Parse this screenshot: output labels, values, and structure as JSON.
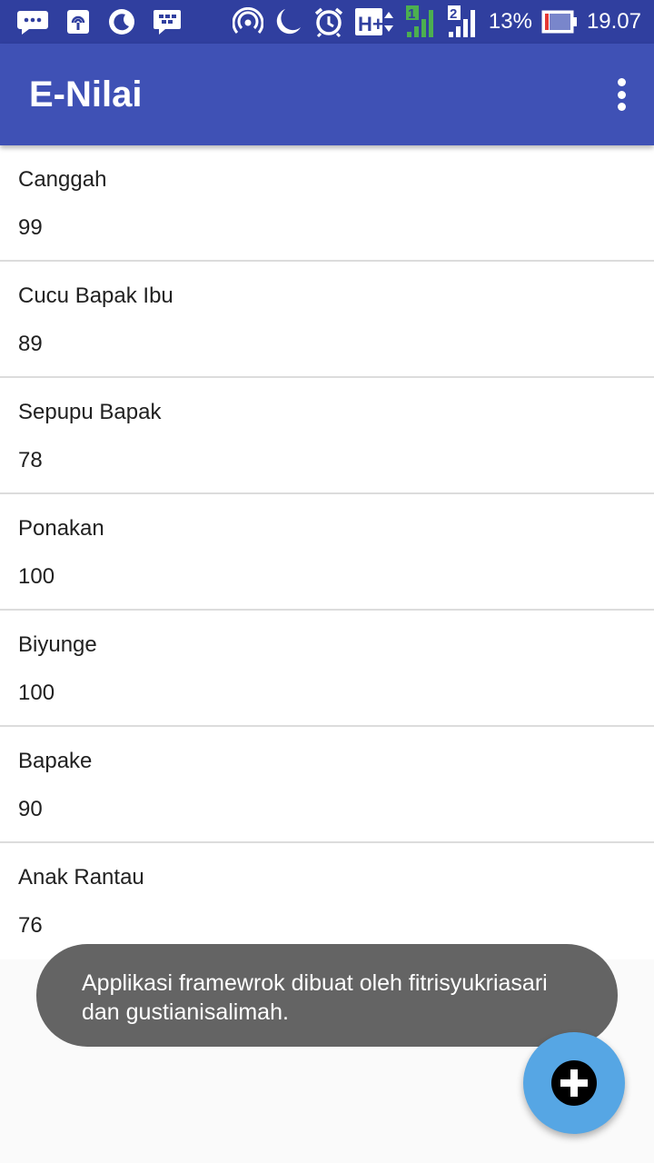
{
  "status_bar": {
    "battery_percent": "13%",
    "time": "19.07",
    "network_type": "H+",
    "sim1_label": "1",
    "sim2_label": "2",
    "icons": [
      "messaging-icon",
      "hotspot-icon",
      "night-mode-icon",
      "bbm-icon",
      "wifi-hotspot-icon",
      "moon-icon",
      "alarm-icon",
      "network-h-plus-icon",
      "signal-sim1-icon",
      "signal-sim2-icon",
      "battery-icon"
    ],
    "battery_level": 0.13
  },
  "app_bar": {
    "title": "E-Nilai",
    "menu_icon": "overflow-menu-icon"
  },
  "list": {
    "items": [
      {
        "name": "Canggah",
        "score": "99"
      },
      {
        "name": "Cucu Bapak Ibu",
        "score": "89"
      },
      {
        "name": "Sepupu Bapak",
        "score": "78"
      },
      {
        "name": "Ponakan",
        "score": "100"
      },
      {
        "name": "Biyunge",
        "score": "100"
      },
      {
        "name": "Bapake",
        "score": "90"
      },
      {
        "name": "Anak Rantau",
        "score": "76"
      }
    ]
  },
  "toast": {
    "line1": "Applikasi framewrok dibuat oleh fitrisyukriasari",
    "line2": "dan gustianisalimah."
  },
  "fab": {
    "icon": "add-icon"
  },
  "colors": {
    "status_bar": "#303f9f",
    "app_bar": "#3f51b5",
    "fab": "#56a6e4",
    "toast": "#646464"
  }
}
